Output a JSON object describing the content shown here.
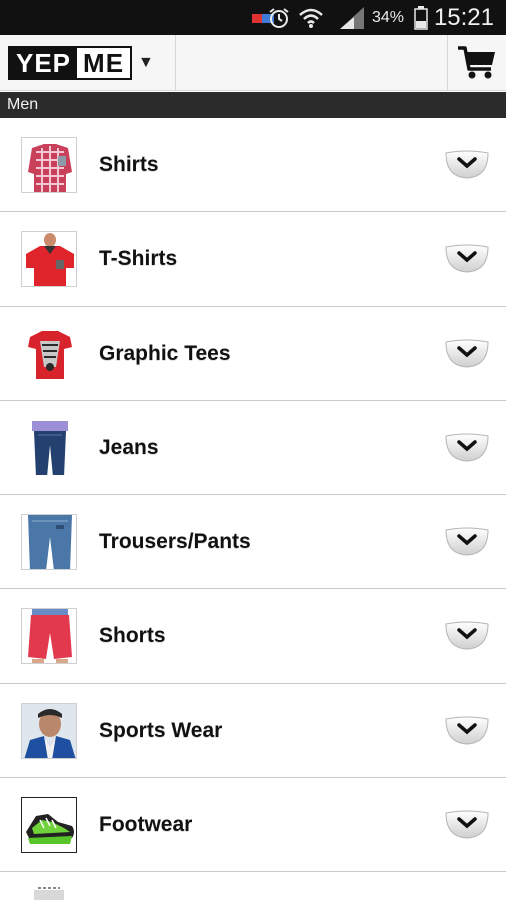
{
  "status_bar": {
    "battery_percent": "34%",
    "time": "15:21"
  },
  "header": {
    "logo_left": "YEP",
    "logo_right": "ME"
  },
  "section": {
    "title": "Men"
  },
  "categories": [
    {
      "label": "Shirts",
      "thumb": "checked-shirt"
    },
    {
      "label": "T-Shirts",
      "thumb": "red-polo"
    },
    {
      "label": "Graphic Tees",
      "thumb": "red-graphic-tee"
    },
    {
      "label": "Jeans",
      "thumb": "blue-jeans"
    },
    {
      "label": "Trousers/Pants",
      "thumb": "blue-trousers"
    },
    {
      "label": "Shorts",
      "thumb": "red-shorts"
    },
    {
      "label": "Sports Wear",
      "thumb": "sports-jacket"
    },
    {
      "label": "Footwear",
      "thumb": "green-sneaker"
    }
  ],
  "colors": {
    "status_bar": "#111111",
    "section_bar": "#2b2b2b",
    "row_divider": "#c9c9c9"
  }
}
